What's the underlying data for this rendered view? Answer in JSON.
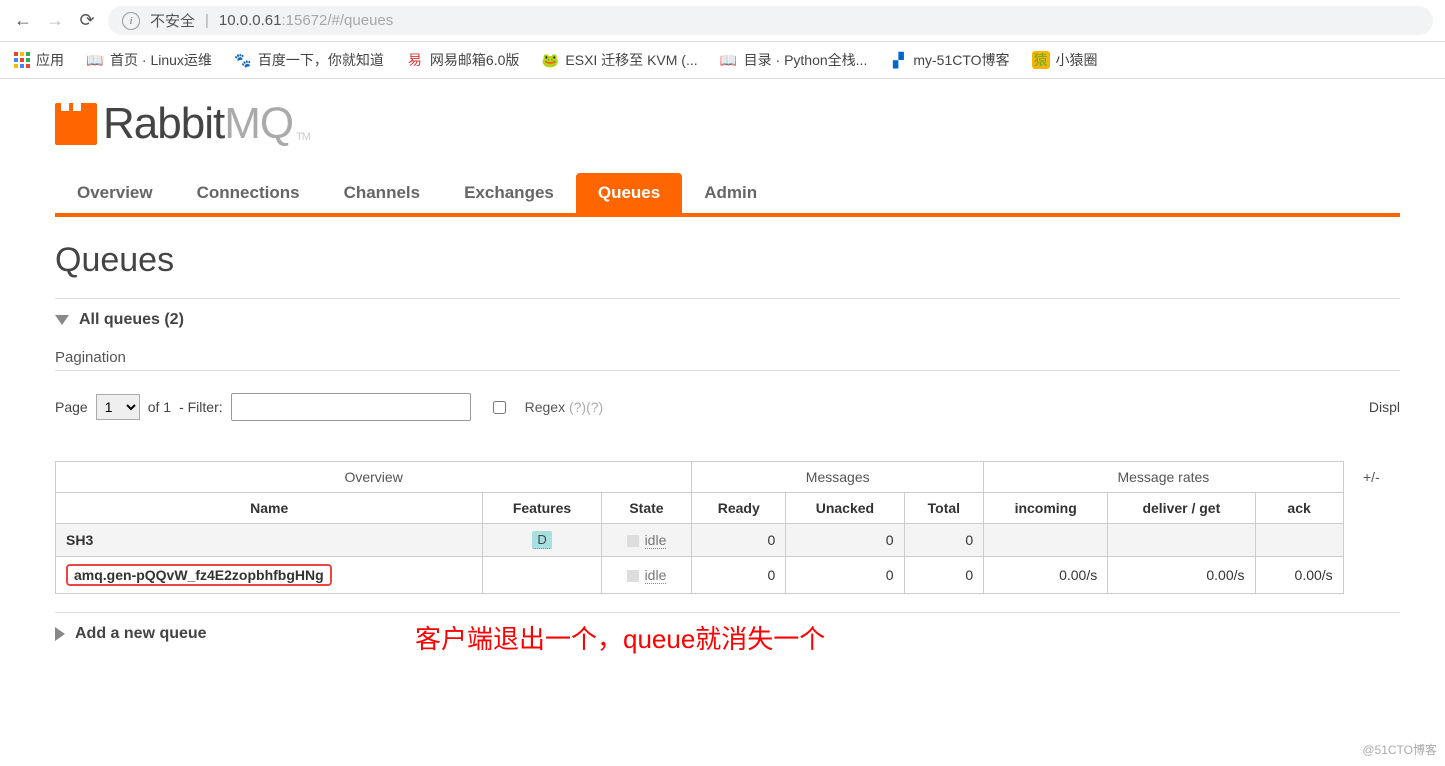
{
  "browser": {
    "insecure": "不安全",
    "url_host": "10.0.0.61",
    "url_rest": ":15672/#/queues"
  },
  "bookmarks_bar": {
    "apps": "应用",
    "items": [
      {
        "label": "首页 · Linux运维"
      },
      {
        "label": "百度一下，你就知道"
      },
      {
        "label": "网易邮箱6.0版"
      },
      {
        "label": "ESXI 迁移至 KVM (..."
      },
      {
        "label": "目录 · Python全栈..."
      },
      {
        "label": "my-51CTO博客"
      },
      {
        "label": "小猿圈"
      }
    ]
  },
  "logo": {
    "rabbit": "Rabbit",
    "mq": "MQ"
  },
  "tabs": [
    {
      "label": "Overview"
    },
    {
      "label": "Connections"
    },
    {
      "label": "Channels"
    },
    {
      "label": "Exchanges"
    },
    {
      "label": "Queues",
      "active": true
    },
    {
      "label": "Admin"
    }
  ],
  "page_title": "Queues",
  "sections": {
    "all_queues": "All queues (2)",
    "pagination": "Pagination",
    "add_new": "Add a new queue"
  },
  "pagination": {
    "page_label": "Page",
    "page_value": "1",
    "of_total": "of 1",
    "filter_label": "- Filter:",
    "regex_label": "Regex",
    "regex_help1": "(?)",
    "regex_help2": "(?)",
    "display": "Displ"
  },
  "annotation": "客户端退出一个，queue就消失一个",
  "table": {
    "groups": {
      "overview": "Overview",
      "messages": "Messages",
      "rates": "Message rates",
      "pm": "+/-"
    },
    "cols": {
      "name": "Name",
      "features": "Features",
      "state": "State",
      "ready": "Ready",
      "unacked": "Unacked",
      "total": "Total",
      "incoming": "incoming",
      "deliver": "deliver / get",
      "ack": "ack"
    },
    "rows": [
      {
        "name": "SH3",
        "feature": "D",
        "state": "idle",
        "ready": "0",
        "unacked": "0",
        "total": "0",
        "incoming": "",
        "deliver": "",
        "ack": "",
        "highlight": false
      },
      {
        "name": "amq.gen-pQQvW_fz4E2zopbhfbgHNg",
        "feature": "",
        "state": "idle",
        "ready": "0",
        "unacked": "0",
        "total": "0",
        "incoming": "0.00/s",
        "deliver": "0.00/s",
        "ack": "0.00/s",
        "highlight": true
      }
    ]
  },
  "watermark": "@51CTO博客"
}
